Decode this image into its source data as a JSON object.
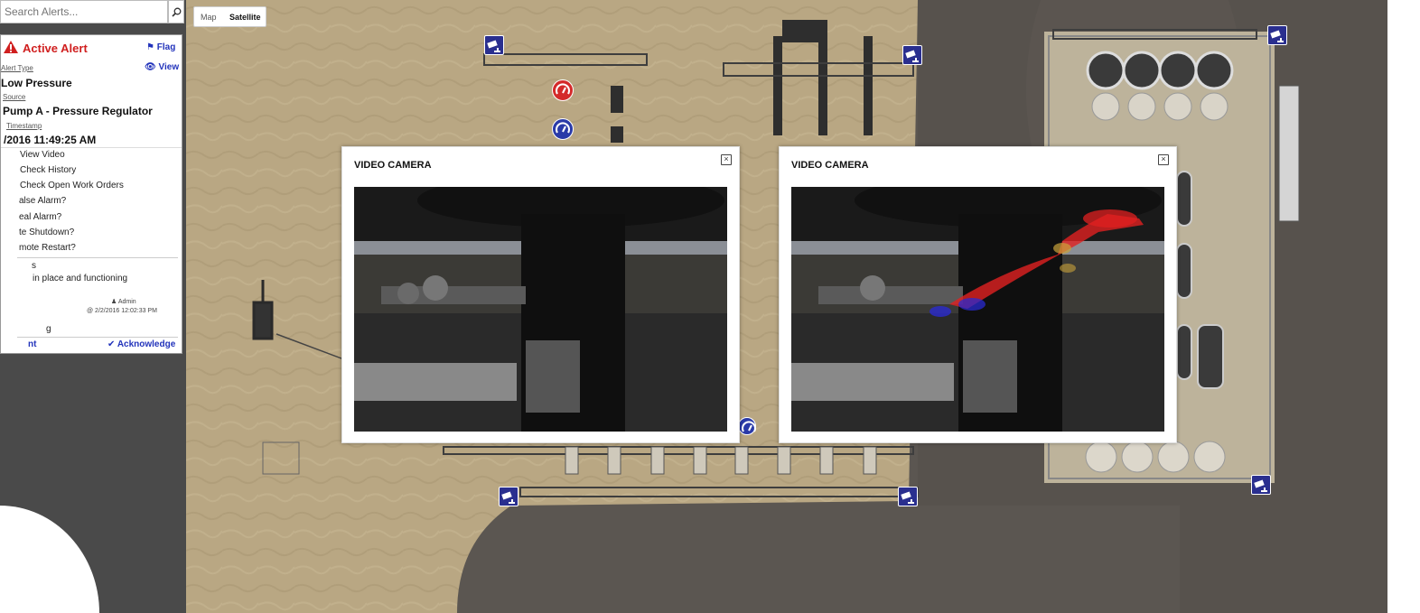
{
  "search": {
    "placeholder": "Search Alerts..."
  },
  "map_toggle": {
    "map_label": "Map",
    "satellite_label": "Satellite"
  },
  "alert": {
    "title": "Active Alert",
    "flag_label": "Flag",
    "view_label": "View",
    "type_label": "Alert Type",
    "type_value": "Low Pressure",
    "source_label": "Source",
    "source_value": "Pump A - Pressure Regulator",
    "timestamp_label": "Timestamp",
    "timestamp_value": "/2016 11:49:25 AM",
    "actions": [
      "View Video",
      "Check History",
      "Check Open Work Orders",
      "alse Alarm?",
      "eal Alarm?",
      "te Shutdown?",
      "mote Restart?"
    ],
    "notes_label": "s",
    "note_text": "in place and functioning",
    "note_author": "Admin",
    "note_time": "@ 2/2/2016 12:02:33 PM",
    "log_label": "g",
    "print_label": "nt",
    "acknowledge_label": "Acknowledge"
  },
  "video_popups": [
    {
      "title": "VIDEO CAMERA"
    },
    {
      "title": "VIDEO CAMERA"
    }
  ],
  "colors": {
    "alert_red": "#d01f1f",
    "link_blue": "#2233bb",
    "camera_marker": "#2a2f8f",
    "gauge_alarm": "#d42a2a",
    "gauge_normal": "#2a3aa8",
    "thermal_overlay": "#e02020"
  },
  "icons": [
    "search-icon",
    "warning-icon",
    "flag-icon",
    "eye-icon",
    "user-icon",
    "check-icon",
    "close-icon",
    "camera-icon",
    "gauge-icon"
  ]
}
